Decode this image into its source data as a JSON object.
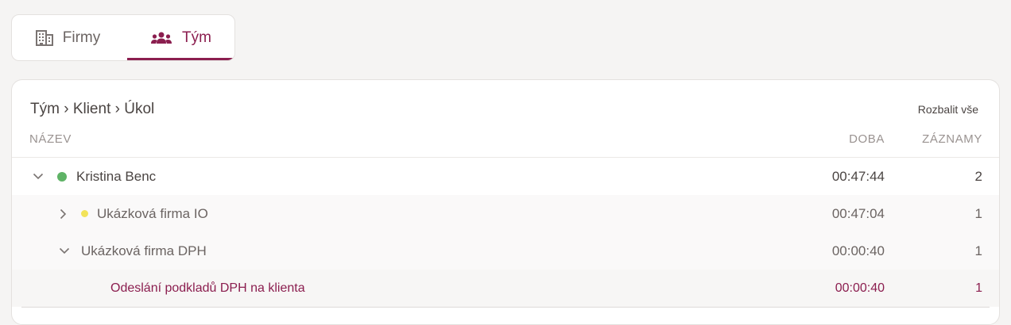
{
  "tabs": [
    {
      "label": "Firmy",
      "icon": "building-icon",
      "active": false
    },
    {
      "label": "Tým",
      "icon": "team-icon",
      "active": true
    }
  ],
  "accent_color": "#8b1e4f",
  "breadcrumb": "Tým › Klient › Úkol",
  "expand_all_label": "Rozbalit vše",
  "columns": {
    "name": "NÁZEV",
    "time": "DOBA",
    "records": "ZÁZNAMY"
  },
  "rows": [
    {
      "name": "Kristina Benc",
      "time": "00:47:44",
      "records": "2",
      "status_color": "#5fb366",
      "expanded": true
    },
    {
      "name": "Ukázková firma IO",
      "time": "00:47:04",
      "records": "1",
      "status_color": "#f2e35a",
      "expanded": false
    },
    {
      "name": "Ukázková firma DPH",
      "time": "00:00:40",
      "records": "1",
      "expanded": true
    },
    {
      "name": "Odeslání podkladů DPH na klienta",
      "time": "00:00:40",
      "records": "1"
    }
  ]
}
